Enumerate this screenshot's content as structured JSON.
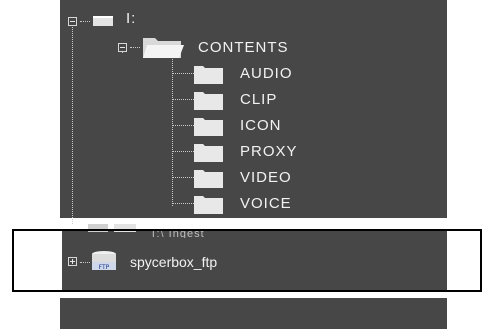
{
  "tree": {
    "drive": {
      "label": "I:",
      "expanded": true,
      "icon": "drive-icon"
    },
    "contents": {
      "label": "CONTENTS",
      "expanded": true,
      "icon": "open-folder-icon",
      "children": [
        {
          "label": "AUDIO",
          "icon": "folder-icon"
        },
        {
          "label": "CLIP",
          "icon": "folder-icon"
        },
        {
          "label": "ICON",
          "icon": "folder-icon"
        },
        {
          "label": "PROXY",
          "icon": "folder-icon"
        },
        {
          "label": "VIDEO",
          "icon": "folder-icon"
        },
        {
          "label": "VOICE",
          "icon": "folder-icon"
        }
      ]
    },
    "ftp": {
      "label": "spycerbox_ftp",
      "expanded": false,
      "icon": "ftp-server-icon"
    },
    "partial_label": "T:\\ Ingest"
  },
  "colors": {
    "panel": "#474747",
    "label": "#f2f2f2",
    "folder": "#e8e8e8",
    "frame": "#000000"
  }
}
